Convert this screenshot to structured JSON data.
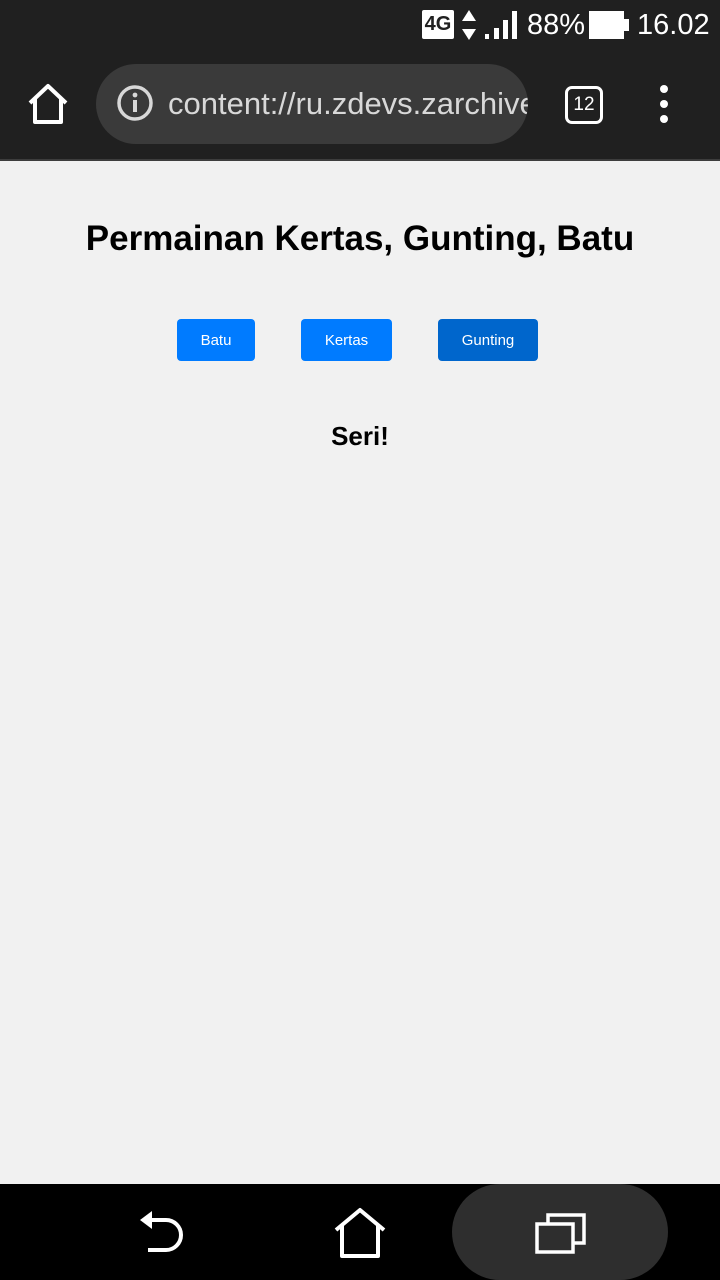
{
  "status_bar": {
    "network": "4G",
    "battery_percent": "88%",
    "time": "16.02",
    "icons": [
      "data-arrows-icon",
      "signal-icon",
      "battery-icon"
    ]
  },
  "browser": {
    "url": "content://ru.zdevs.zarchiver.pro.system.FileProvider",
    "tab_count": "12",
    "icons": [
      "home-icon",
      "info-icon",
      "tabs-icon",
      "more-vert-icon"
    ]
  },
  "page": {
    "title": "Permainan Kertas, Gunting, Batu",
    "buttons": {
      "batu": "Batu",
      "kertas": "Kertas",
      "gunting": "Gunting"
    },
    "result": "Seri!"
  },
  "colors": {
    "button_primary": "#007bff",
    "button_active": "#0066cc",
    "chrome_dark": "#202020",
    "page_bg": "#f1f1f1"
  },
  "nav_bar": {
    "icons": [
      "back-icon",
      "home-icon",
      "recents-icon"
    ]
  }
}
